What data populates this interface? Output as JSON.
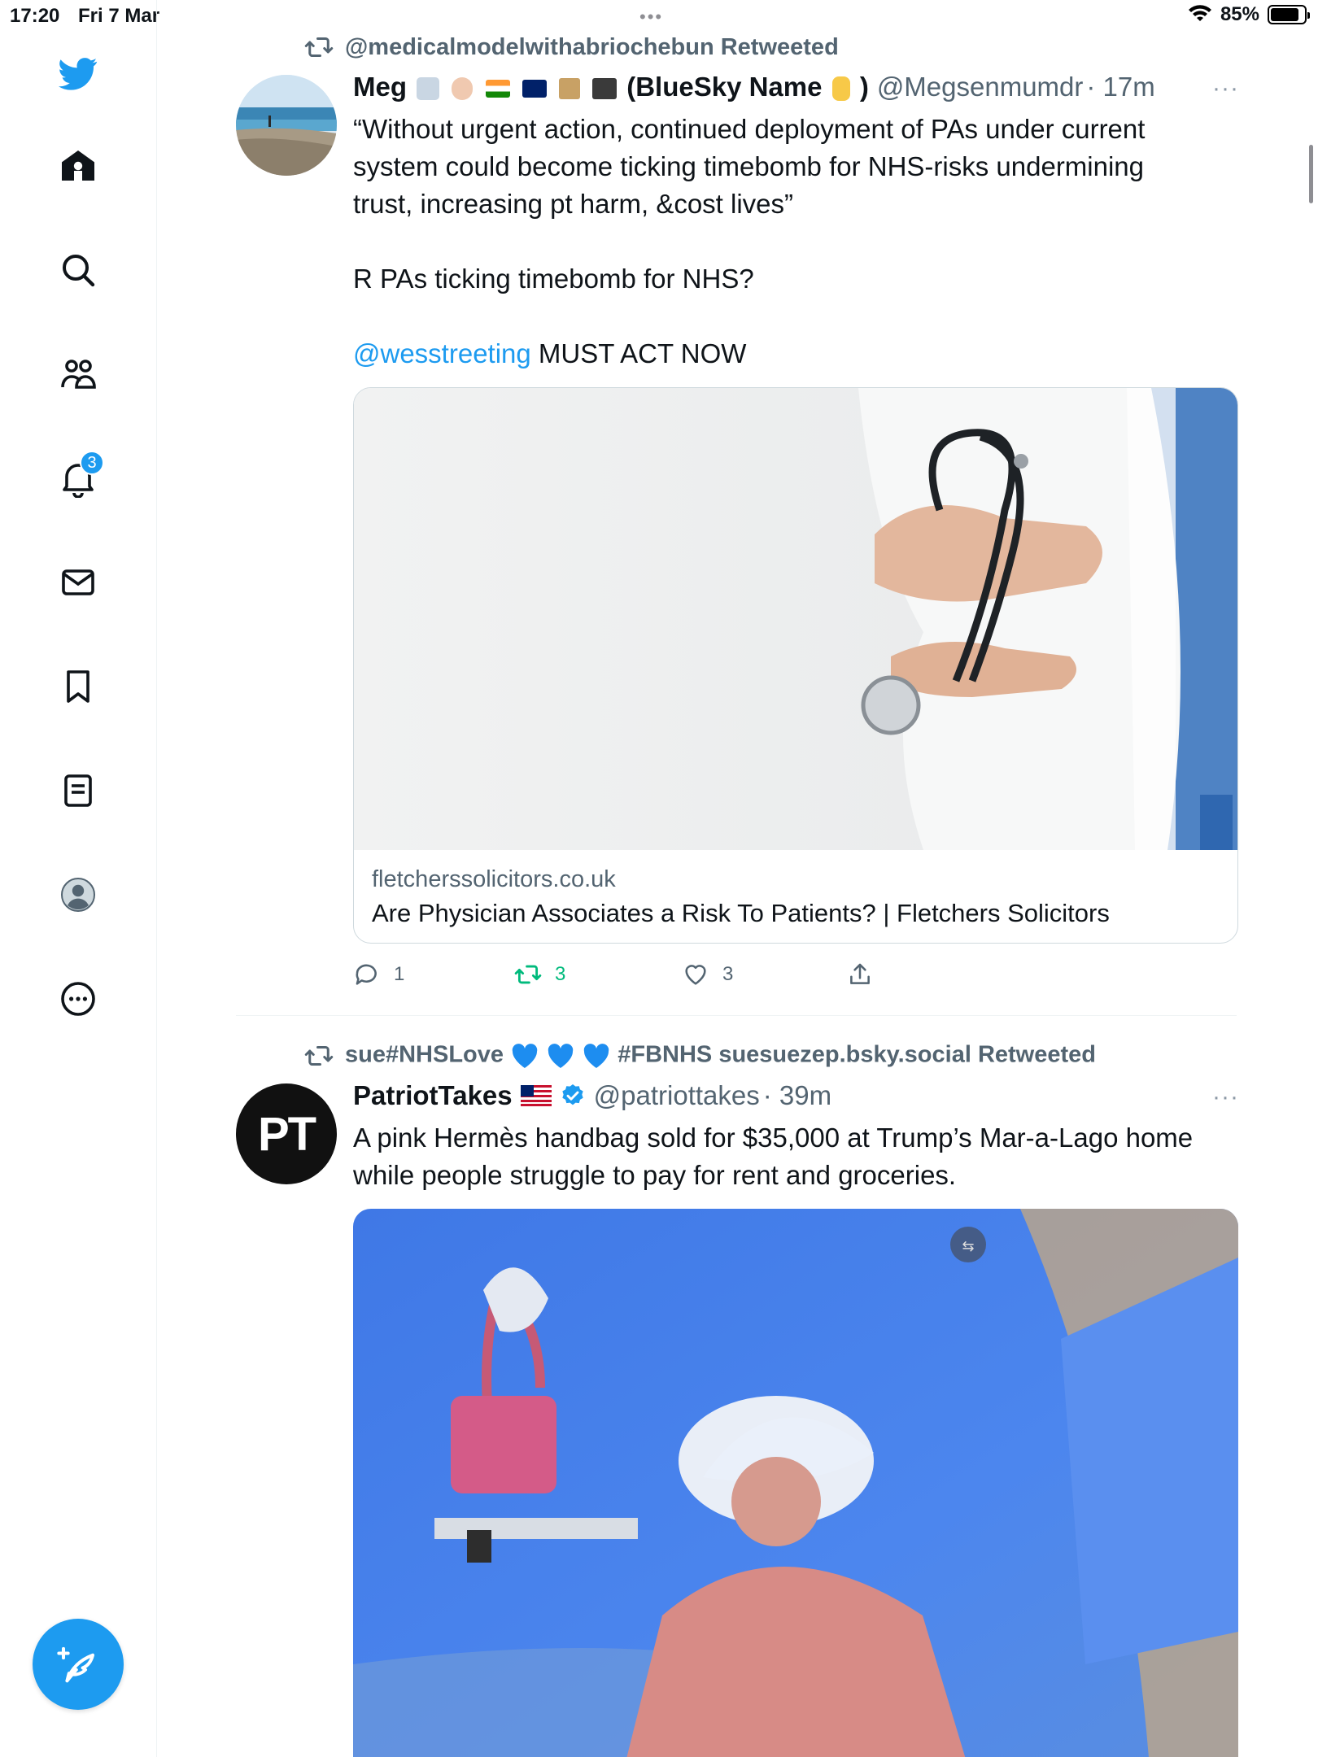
{
  "status_bar": {
    "time": "17:20",
    "date": "Fri 7 Mar",
    "battery": "85%",
    "battery_level": 0.85
  },
  "sidebar": {
    "items": [
      {
        "icon": "twitter-bird-icon"
      },
      {
        "icon": "home-icon"
      },
      {
        "icon": "search-icon"
      },
      {
        "icon": "communities-icon"
      },
      {
        "icon": "notifications-icon",
        "badge": "3"
      },
      {
        "icon": "messages-icon"
      },
      {
        "icon": "bookmarks-icon"
      },
      {
        "icon": "lists-icon"
      },
      {
        "icon": "profile-icon"
      },
      {
        "icon": "more-icon"
      }
    ],
    "compose_icon": "compose-tweet-icon"
  },
  "colors": {
    "accent": "#1d9bf0",
    "retweet_green": "#00ba7c",
    "muted": "#536471"
  },
  "tweets": [
    {
      "retweeted_by": "@medicalmodelwithabriochebun Retweeted",
      "name": "Meg",
      "name_suffix": "(BlueSky Name",
      "name_suffix_close": ")",
      "handle": "@Megsenmumdr",
      "time": "· 17m",
      "more": "···",
      "text_line1": "“Without urgent action, continued deployment of PAs under current",
      "text_line2": "system could become ticking timebomb for NHS-risks undermining",
      "text_line3": "trust, increasing pt harm, &cost lives”",
      "text_line4": "R PAs ticking timebomb for NHS?",
      "mention": "@wesstreeting",
      "text_line5_rest": " MUST ACT NOW",
      "card": {
        "domain": "fletcherssolicitors.co.uk",
        "title": "Are Physician Associates a Risk To Patients? | Fletchers Solicitors"
      },
      "actions": {
        "replies": "1",
        "retweets": "3",
        "likes": "3"
      }
    },
    {
      "retweeted_by_prefix": "sue#NHSLove",
      "retweeted_by_suffix": "#FBNHS suesuezep.bsky.social Retweeted",
      "name": "PatriotTakes",
      "handle": "@patriottakes",
      "time": "· 39m",
      "more": "···",
      "avatar_text": "PT",
      "text_line1": "A pink Hermès handbag sold for $35,000 at Trump’s Mar-a-Lago home",
      "text_line2": "while people struggle to pay for rent and groceries."
    }
  ]
}
